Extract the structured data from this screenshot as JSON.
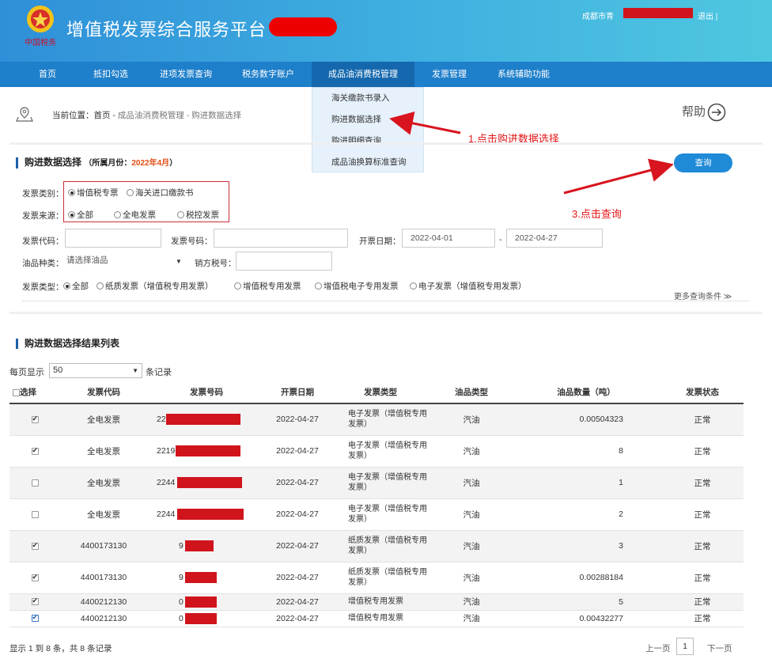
{
  "header": {
    "title": "增值税发票综合服务平台",
    "user_prefix": "成都市青",
    "logout": "退出 |"
  },
  "nav": [
    "首页",
    "抵扣勾选",
    "进项发票查询",
    "税务数字账户",
    "成品油消费税管理",
    "发票管理",
    "系统辅助功能"
  ],
  "dropdown": [
    "海关缴款书录入",
    "购进数据选择",
    "购进明细查询",
    "成品油换算标准查询"
  ],
  "breadcrumb": {
    "prefix": "当前位置：首页 - ",
    "path": "成品油消费税管理 - 购进数据选择"
  },
  "help": "帮助",
  "annotations": {
    "step1": "1.点击购进数据选择",
    "step3": "3.点击查询"
  },
  "query_section": {
    "title": "购进数据选择",
    "period_label": "（所属月份：",
    "period_value": "2022年4月",
    "period_close": "）"
  },
  "query_button": "查询",
  "form": {
    "invoice_class_label": "发票类别：",
    "invoice_class_options": [
      "增值税专票",
      "海关进口缴款书"
    ],
    "source_label": "发票来源：",
    "source_options": [
      "全部",
      "全电发票",
      "税控发票"
    ],
    "code_label": "发票代码：",
    "number_label": "发票号码：",
    "date_label": "开票日期：",
    "date_from": "2022-04-01",
    "date_sep": "-",
    "date_to": "2022-04-27",
    "oil_label": "油品种类：",
    "oil_placeholder": "请选择油品",
    "seller_label": "销方税号：",
    "type_label": "发票类型：",
    "type_options": [
      "全部",
      "纸质发票（增值税专用发票）",
      "增值税专用发票",
      "增值税电子专用发票",
      "电子发票（增值税专用发票）"
    ],
    "more": "更多查询条件"
  },
  "results": {
    "title": "购进数据选择结果列表",
    "per_page_label": "每页显示",
    "per_page_value": "50",
    "per_page_suffix": "条记录",
    "headers": [
      "选择",
      "发票代码",
      "发票号码",
      "开票日期",
      "发票类型",
      "油品类型",
      "油品数量（吨）",
      "发票状态"
    ],
    "rows": [
      {
        "code": "全电发票",
        "num": "22",
        "date": "2022-04-27",
        "type": "电子发票（增值税专用发票）",
        "oil": "汽油",
        "qty": "0.00504323",
        "status": "正常"
      },
      {
        "code": "全电发票",
        "num": "2219",
        "date": "2022-04-27",
        "type": "电子发票（增值税专用发票）",
        "oil": "汽油",
        "qty": "8",
        "status": "正常"
      },
      {
        "code": "全电发票",
        "num": "2244",
        "date": "2022-04-27",
        "type": "电子发票（增值税专用发票）",
        "oil": "汽油",
        "qty": "1",
        "status": "正常"
      },
      {
        "code": "全电发票",
        "num": "2244",
        "date": "2022-04-27",
        "type": "电子发票（增值税专用发票）",
        "oil": "汽油",
        "qty": "2",
        "status": "正常"
      },
      {
        "code": "4400173130",
        "num": "9",
        "date": "2022-04-27",
        "type": "纸质发票（增值税专用发票）",
        "oil": "汽油",
        "qty": "3",
        "status": "正常"
      },
      {
        "code": "4400173130",
        "num": "9",
        "date": "2022-04-27",
        "type": "纸质发票（增值税专用发票）",
        "oil": "汽油",
        "qty": "0.00288184",
        "status": "正常"
      },
      {
        "code": "4400212130",
        "num": "0",
        "date": "2022-04-27",
        "type": "增值税专用发票",
        "oil": "汽油",
        "qty": "5",
        "status": "正常"
      },
      {
        "code": "4400212130",
        "num": "0",
        "date": "2022-04-27",
        "type": "增值税专用发票",
        "oil": "汽油",
        "qty": "0.00432277",
        "status": "正常"
      }
    ],
    "footer": "显示 1 到 8 条，共 8 条记录",
    "prev": "上一页",
    "page": "1",
    "next": "下一页"
  }
}
